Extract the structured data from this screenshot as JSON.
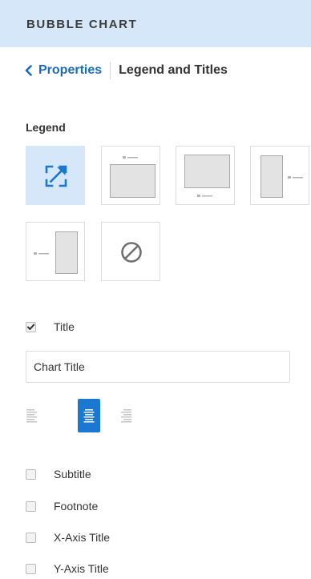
{
  "header": {
    "title": "BUBBLE CHART"
  },
  "breadcrumb": {
    "back_label": "Properties",
    "current": "Legend and Titles"
  },
  "legend": {
    "label": "Legend",
    "options": [
      {
        "name": "auto",
        "icon": "auto-position-icon",
        "selected": true
      },
      {
        "name": "top",
        "icon": "legend-top-icon",
        "selected": false
      },
      {
        "name": "bottom",
        "icon": "legend-bottom-icon",
        "selected": false
      },
      {
        "name": "right",
        "icon": "legend-right-icon",
        "selected": false
      },
      {
        "name": "left",
        "icon": "legend-left-icon",
        "selected": false
      },
      {
        "name": "none",
        "icon": "no-legend-icon",
        "selected": false
      }
    ]
  },
  "title_option": {
    "label": "Title",
    "checked": true,
    "input_value": "Chart Title"
  },
  "alignment": {
    "options": [
      "left",
      "center",
      "right"
    ],
    "selected": "center"
  },
  "other_titles": [
    {
      "label": "Subtitle",
      "checked": false
    },
    {
      "label": "Footnote",
      "checked": false
    },
    {
      "label": "X-Axis Title",
      "checked": false
    },
    {
      "label": "Y-Axis Title",
      "checked": false
    }
  ],
  "colors": {
    "accent": "#1a78d1",
    "header_bg": "#d5e7f8",
    "link": "#1a6bb8"
  }
}
